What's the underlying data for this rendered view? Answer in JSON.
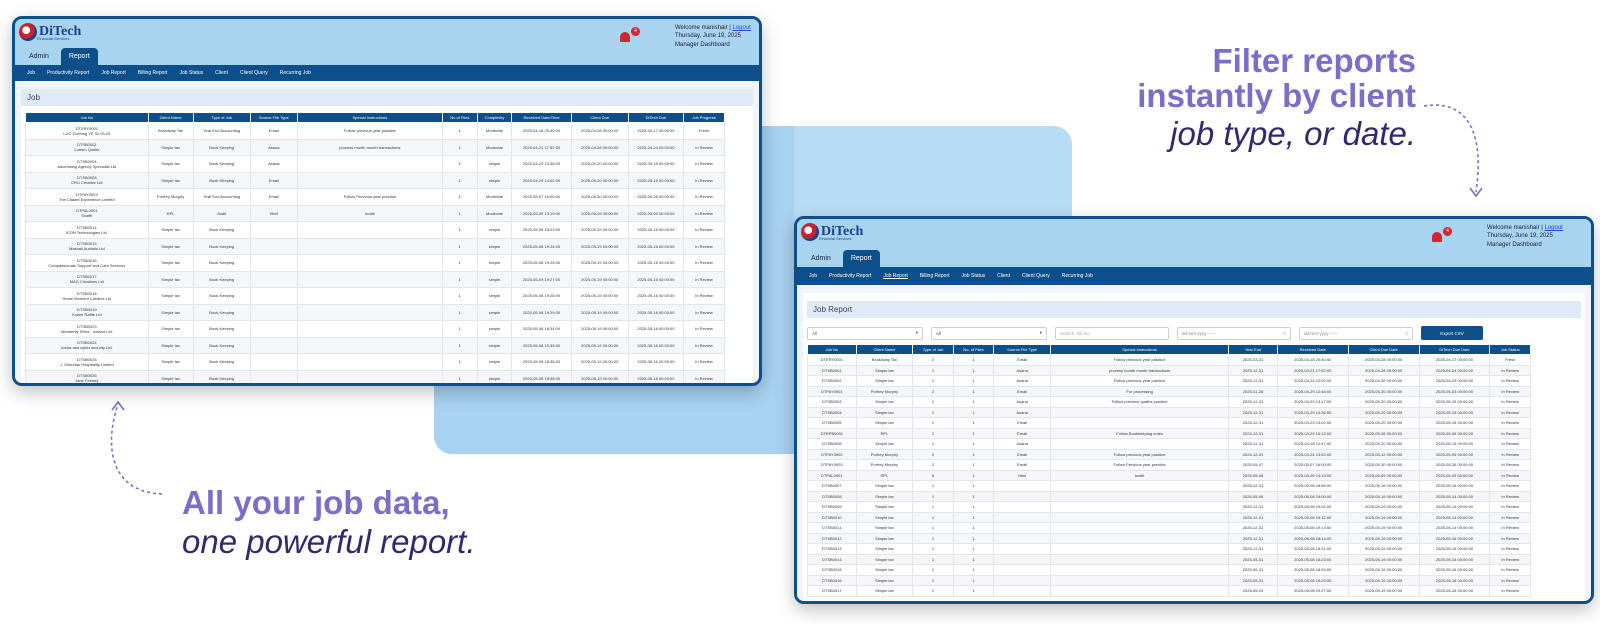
{
  "marketing": {
    "right_headline_bold_1": "Filter reports",
    "right_headline_bold_2": "instantly by client",
    "right_headline_italic": "job type, or date.",
    "left_headline_bold": "All your job data,",
    "left_headline_italic": "one powerful report."
  },
  "colors": {
    "accent": "#7a6fc8",
    "navy": "#0d4f8b",
    "topbar": "#a9d4f0",
    "badge": "#d8242e"
  },
  "app": {
    "logo_text": "DiTech",
    "logo_sub": "Financial Services",
    "welcome": "Welcome manishair |",
    "logout": "Logout",
    "date": "Thursday, June 19, 2025",
    "dashboard": "Manager Dashboard",
    "notif_count": "4",
    "main_tabs": [
      "Admin",
      "Report"
    ],
    "sub_nav": [
      "Job",
      "Productivity Report",
      "Job Report",
      "Billing Report",
      "Job Status",
      "Client",
      "Client Query",
      "Recurring Job"
    ]
  },
  "job_screen": {
    "title": "Job",
    "columns": [
      "Job No",
      "Client Name",
      "Type of Job",
      "Source File Type",
      "Special Instructions",
      "No of Files",
      "Complexity",
      "Received Date/Time",
      "Client Due",
      "DiTech Due",
      "Job Progress"
    ],
    "rows": [
      [
        "DTERY0001\nLUC Clothing YE 31.03.25",
        "Broadway Tax",
        "Year End Accounting",
        "Email",
        "Follow previous year practice",
        "1",
        "Moderate",
        "2025-04-18 20:40:00",
        "2025-04-28 00:00:00",
        "2025-04-17 00:00:00",
        "Fresh"
      ],
      [
        "DTSB0001\nLumen Quirks",
        "Simple tax",
        "Book Keeping",
        "Asana",
        "process month month transactions",
        "1",
        "Moderate",
        "2025-04-21 17:52:00",
        "2025-04-28 00:00:00",
        "2025-04-24 00:00:00",
        "In Review"
      ],
      [
        "DTSB0004\nAdvertising Agency Specialist Ltd",
        "Simple tax",
        "Book Keeping",
        "Asana",
        "",
        "1",
        "simple",
        "2025-04-29 13:36:00",
        "2025-05-20 00:00:00",
        "2025-05-15 00:00:00",
        "In Review"
      ],
      [
        "DTSB0005\nCRU Creative Ltd",
        "Simple tax",
        "Book Keeping",
        "Email",
        "",
        "1",
        "simple",
        "2025-04-29 14:02:00",
        "2025-05-20 00:00:00",
        "2025-05-15 00:00:00",
        "In Review"
      ],
      [
        "DTPAY0003\nThe Citadel Experience Limited",
        "Porfrey Murphy",
        "Year End Accounting",
        "Email",
        "Follow Previous year practice",
        "1",
        "Moderate",
        "2025-05-07 16:00:00",
        "2025-05-30 00:00:00",
        "2025-05-26 00:00:00",
        "In Review"
      ],
      [
        "DTPAL0001\nScoffit",
        "RPL",
        "Audit",
        "Html",
        "tooltit",
        "1",
        "Moderate",
        "2025-05-09 13:19:00",
        "2025-05-09 00:00:00",
        "2025-05-09 00:00:00",
        "In Review"
      ],
      [
        "DTSB0014\nICON Technologies Ltd.",
        "Simple tax",
        "Book Keeping",
        "",
        "",
        "1",
        "simple",
        "2025-05-08 18:23:00",
        "2025-05-19 00:00:00",
        "2025-05-16 00:00:00",
        "In Review"
      ],
      [
        "DTSB0015\nMashall Audiotic Ltd",
        "Simple tax",
        "Book Keeping",
        "",
        "",
        "1",
        "simple",
        "2025-05-08 19:24:00",
        "2025-05-19 00:00:00",
        "2025-05-16 00:00:00",
        "In Review"
      ],
      [
        "DTSB0016\nCompassionate Support and Care Services",
        "Simple tax",
        "Book Keeping",
        "",
        "",
        "1",
        "simple",
        "2025-05-08 19:25:00",
        "2025-05-19 00:00:00",
        "2025-05-16 00:00:00",
        "In Review"
      ],
      [
        "DTSB0017\nM&G Creations Ltd",
        "Simple tax",
        "Book Keeping",
        "",
        "",
        "1",
        "simple",
        "2025-05-09 19:27:00",
        "2025-05-19 00:00:00",
        "2025-05-16 00:00:00",
        "In Review"
      ],
      [
        "DTSB0018\nHome Moment Candles Ltd",
        "Simple tax",
        "Book Keeping",
        "",
        "",
        "1",
        "simple",
        "2025-05-08 19:28:00",
        "2025-05-19 00:00:00",
        "2025-05-16 00:00:00",
        "In Review"
      ],
      [
        "DTSB0019\nKolme Raffle Ltd",
        "Simple tax",
        "Book Keeping",
        "",
        "",
        "1",
        "simple",
        "2025-05-08 19:29:00",
        "2025-05-19 00:00:00",
        "2025-05-16 00:00:00",
        "In Review"
      ],
      [
        "DTSB0023\nWonderfly Films - Ireland Ltd.",
        "Simple tax",
        "Book Keeping",
        "",
        "",
        "1",
        "simple",
        "2025-05-08 18:34:00",
        "2025-05-19 00:00:00",
        "2025-05-16 00:00:00",
        "In Review"
      ],
      [
        "DTSB0024\nArcha and cyber security Ltd.",
        "Simple tax",
        "Book Keeping",
        "",
        "",
        "1",
        "simple",
        "2025-05-08 19:35:00",
        "2025-05-19 00:00:00",
        "2025-05-16 00:00:00",
        "In Review"
      ],
      [
        "DTSB0025\nJ. Sheridan Hospitality Limited",
        "Simple tax",
        "Book Keeping",
        "",
        "",
        "1",
        "simple",
        "2025-05-08 18:38:00",
        "2025-05-19 00:00:00",
        "2025-05-16 00:00:00",
        "In Review"
      ],
      [
        "DTSB0026\nJane Feeney",
        "Simple tax",
        "Book Keeping",
        "",
        "",
        "1",
        "simple",
        "2025-05-08 18:38:00",
        "2025-05-19 00:00:00",
        "2025-05-16 00:00:00",
        "In Review"
      ]
    ]
  },
  "job_report": {
    "title": "Job Report",
    "filters": {
      "client": "All",
      "job_type": "All",
      "search_placeholder": "Search Job No",
      "from_date": "dd-mm-yyyy --:--",
      "to_date": "dd-mm-yyyy --:--",
      "export": "Export CSV"
    },
    "columns": [
      "Job No",
      "Client Name",
      "Type of Job",
      "No. of Files",
      "Source File Type",
      "Special Instructions",
      "Year End",
      "Received Date",
      "Client Due Date",
      "DiTech Due Date",
      "Job Status"
    ],
    "rows": [
      [
        "DTERY0001",
        "Broadway Tax",
        "2",
        "1",
        "Email",
        "Follow previous year practice",
        "2025-03-31",
        "2025-04-18 20:40:00",
        "2025-04-28 00:00:00",
        "2025-04-17 00:00:00",
        "Fresh"
      ],
      [
        "DTSB0001",
        "Simple tax",
        "1",
        "1",
        "Asana",
        "process month month transactions",
        "2025-12-31",
        "2025-04-21 17:52:00",
        "2025-04-28 00:00:00",
        "2025-04-24 00:00:00",
        "In Review"
      ],
      [
        "DTSB0002",
        "Simple tax",
        "1",
        "1",
        "Asana",
        "Follow previous year practice",
        "2025-12-31",
        "2025-04-24 12:02:00",
        "2025-04-30 00:00:00",
        "2025-04-25 00:00:00",
        "In Review"
      ],
      [
        "DTPAY0001",
        "Porfrey Murphy",
        "2",
        "1",
        "Email",
        "For processing",
        "2025-01-28",
        "2025-04-29 12:48:00",
        "2025-05-30 00:00:00",
        "2025-05-03 00:00:00",
        "In Review"
      ],
      [
        "DTSB0003",
        "Simple tax",
        "1",
        "1",
        "Asana",
        "Follow previous quaths practice",
        "2025-12-31",
        "2025-04-29 13:17:00",
        "2025-05-20 00:00:00",
        "2025-05-15 00:00:00",
        "In Review"
      ],
      [
        "DTSB0004",
        "Simple tax",
        "1",
        "1",
        "Asana",
        "",
        "2025-12-31",
        "2025-04-29 13:36:00",
        "2025-05-20 00:00:00",
        "2025-05-15 00:00:00",
        "In Review"
      ],
      [
        "DTSB0005",
        "Simple tax",
        "1",
        "1",
        "Email",
        "",
        "2025-12-31",
        "2025-04-29 14:02:00",
        "2025-05-20 00:00:00",
        "2025-05-15 00:00:00",
        "In Review"
      ],
      [
        "DTRPB0001",
        "RPL",
        "1",
        "1",
        "Email",
        "Follow Bookkeeping notes",
        "2024-12-31",
        "2025-04-29 10:12:00",
        "2025-05-06 00:00:00",
        "2025-05-06 00:00:00",
        "In Review"
      ],
      [
        "DTSB0006",
        "Simple tax",
        "1",
        "1",
        "Asana",
        "",
        "2025-12-31",
        "2025-04-18 12:47:00",
        "2025-05-20 00:00:00",
        "2025-05-15 00:00:00",
        "In Review"
      ],
      [
        "DTPAY0002",
        "Porfrey Murphy",
        "2",
        "1",
        "Email",
        "Follow previous year practice",
        "2024-12-31",
        "2025-04-24 13:52:00",
        "2025-05-12 00:00:00",
        "2025-05-09 00:00:00",
        "In Review"
      ],
      [
        "DTPAY0003",
        "Porfrey Murphy",
        "2",
        "1",
        "Email",
        "Follow Previous year practice",
        "2025-05-07",
        "2025-05-07 16:00:00",
        "2025-05-30 00:00:00",
        "2025-05-26 00:00:00",
        "In Review"
      ],
      [
        "DTPAL0001",
        "RPL",
        "6",
        "1",
        "Html",
        "tooltit",
        "2025-05-08",
        "2025-05-09 13:19:00",
        "2025-05-09 00:00:00",
        "2025-05-09 00:00:00",
        "In Review"
      ],
      [
        "DTSB0007",
        "Simple tax",
        "1",
        "1",
        "",
        "",
        "2025-12-31",
        "2025-05-08 18:56:00",
        "2025-05-16 00:00:00",
        "2025-05-16 00:00:00",
        "In Review"
      ],
      [
        "DTSB0008",
        "Simple tax",
        "1",
        "1",
        "",
        "",
        "2026-05-09",
        "2025-05-08 19:00:00",
        "2025-05-19 00:00:00",
        "2025-05-14 00:00:00",
        "In Review"
      ],
      [
        "DTSB0009",
        "Simple tax",
        "1",
        "1",
        "",
        "",
        "2025-12-31",
        "2025-05-08 19:01:00",
        "2025-05-19 00:00:00",
        "2025-05-14 00:00:00",
        "In Review"
      ],
      [
        "DTSB0010",
        "Simple tax",
        "1",
        "1",
        "",
        "",
        "2025-12-31",
        "2025-05-08 19:12:00",
        "2025-05-19 00:00:00",
        "2025-05-14 00:00:00",
        "In Review"
      ],
      [
        "DTSB0011",
        "Simple tax",
        "1",
        "1",
        "",
        "",
        "2025-12-31",
        "2025-05-08 19:13:00",
        "2025-05-19 00:00:00",
        "2025-05-14 00:00:00",
        "In Review"
      ],
      [
        "DTSB0012",
        "Simple tax",
        "1",
        "1",
        "",
        "",
        "2025-12-31",
        "2025-05-08 18:14:00",
        "2025-05-19 00:00:00",
        "2025-05-16 00:00:00",
        "In Review"
      ],
      [
        "DTSB0013",
        "Simple tax",
        "1",
        "1",
        "",
        "",
        "2025-12-31",
        "2025-05-08 18:21:00",
        "2025-05-19 00:00:00",
        "2025-05-16 00:00:00",
        "In Review"
      ],
      [
        "DTSB0014",
        "Simple tax",
        "1",
        "1",
        "",
        "",
        "2025-05-31",
        "2025-05-08 18:23:00",
        "2025-05-19 00:00:00",
        "2025-05-16 00:00:00",
        "In Review"
      ],
      [
        "DTSB0015",
        "Simple tax",
        "1",
        "1",
        "",
        "",
        "2025-05-31",
        "2025-05-08 18:24:00",
        "2025-05-19 00:00:00",
        "2025-05-16 00:00:00",
        "In Review"
      ],
      [
        "DTSB0016",
        "Simple tax",
        "1",
        "1",
        "",
        "",
        "2025-05-31",
        "2025-05-08 19:25:00",
        "2025-05-19 00:00:00",
        "2025-05-16 00:00:00",
        "In Review"
      ],
      [
        "DTSB0017",
        "Simple tax",
        "1",
        "1",
        "",
        "",
        "2025-05-19",
        "2025-05-08 19:27:00",
        "2025-05-19 00:00:00",
        "2025-05-16 00:00:00",
        "In Review"
      ]
    ]
  }
}
